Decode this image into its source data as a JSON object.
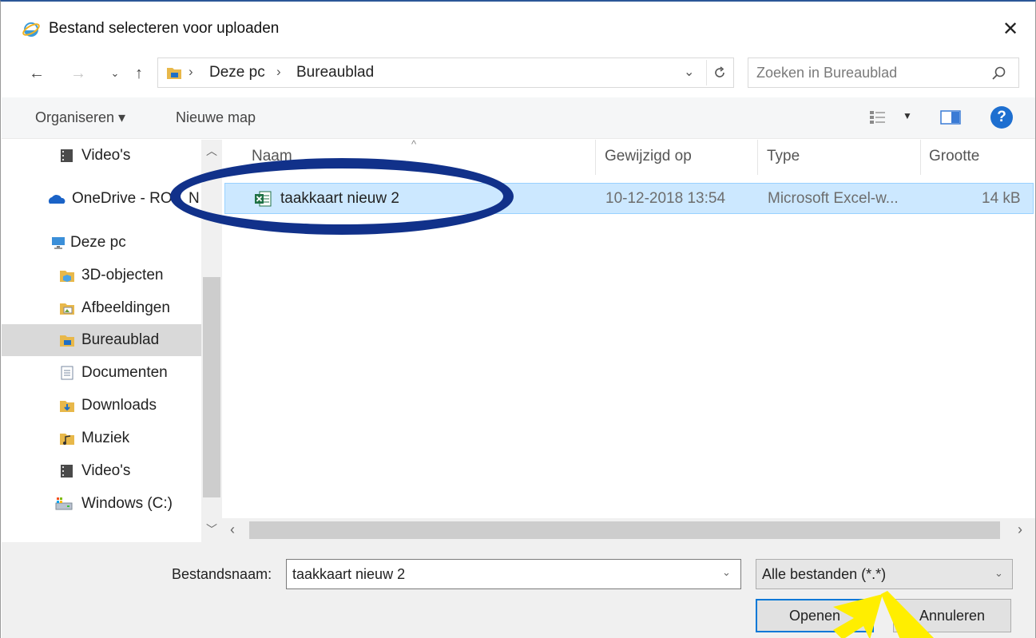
{
  "window": {
    "title": "Bestand selecteren voor uploaden",
    "close_glyph": "✕"
  },
  "address": {
    "crumbs": [
      "Deze pc",
      "Bureaublad"
    ],
    "separator": "›"
  },
  "search": {
    "placeholder": "Zoeken in Bureaublad"
  },
  "toolbar": {
    "organize_label": "Organiseren ▾",
    "new_folder_label": "Nieuwe map"
  },
  "nav": {
    "items": [
      {
        "label": "Video's",
        "icon": "video-folder-icon"
      },
      {
        "label": "OneDrive - RO",
        "icon": "onedrive-icon"
      },
      {
        "label": "Deze pc",
        "icon": "this-pc-icon"
      },
      {
        "label": "3D-objecten",
        "icon": "3d-objects-folder-icon"
      },
      {
        "label": "Afbeeldingen",
        "icon": "pictures-folder-icon"
      },
      {
        "label": "Bureaublad",
        "icon": "desktop-folder-icon",
        "selected": true
      },
      {
        "label": "Documenten",
        "icon": "documents-folder-icon"
      },
      {
        "label": "Downloads",
        "icon": "downloads-folder-icon"
      },
      {
        "label": "Muziek",
        "icon": "music-folder-icon"
      },
      {
        "label": "Video's",
        "icon": "video-folder-icon"
      },
      {
        "label": "Windows (C:)",
        "icon": "drive-icon"
      }
    ],
    "trailing_letter": "N"
  },
  "columns": [
    "Naam",
    "Gewijzigd op",
    "Type",
    "Grootte"
  ],
  "files": [
    {
      "name": "taakkaart nieuw 2",
      "modified": "10-12-2018 13:54",
      "type": "Microsoft Excel-w...",
      "size": "14 kB",
      "selected": true,
      "icon": "excel-file-icon"
    }
  ],
  "bottom": {
    "filename_label": "Bestandsnaam:",
    "filename_value": "taakkaart nieuw 2",
    "filter_label": "Alle bestanden (*.*)",
    "open_label": "Openen",
    "cancel_label": "Annuleren"
  },
  "colors": {
    "annotation_oval": "#11318a",
    "annotation_arrow": "#ffee00",
    "selection": "#cce8ff",
    "accent": "#0078d7"
  }
}
